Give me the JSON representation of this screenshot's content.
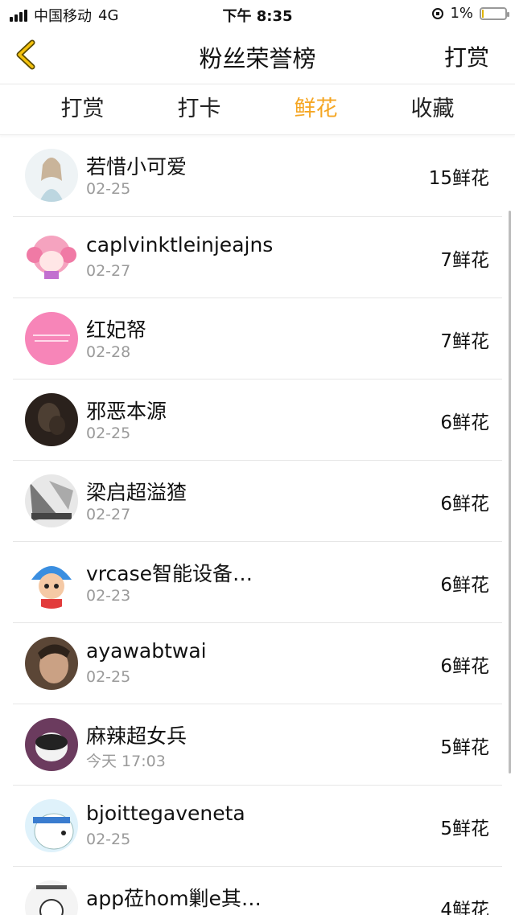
{
  "status": {
    "carrier": "中国移动",
    "network": "4G",
    "time": "下午 8:35",
    "battery": "1%"
  },
  "nav": {
    "title": "粉丝荣誉榜",
    "action": "打赏"
  },
  "tabs": [
    {
      "label": "打赏",
      "active": false
    },
    {
      "label": "打卡",
      "active": false
    },
    {
      "label": "鲜花",
      "active": true
    },
    {
      "label": "收藏",
      "active": false
    }
  ],
  "accent_color": "#f5a623",
  "fans": [
    {
      "name": "若惜小可爱",
      "date": "02-25",
      "count": "15鲜花",
      "avatar": "girl-photo-icon"
    },
    {
      "name": "caplvinktleinjeajns",
      "date": "02-27",
      "count": "7鲜花",
      "avatar": "pink-anime-icon"
    },
    {
      "name": "红妃帑",
      "date": "02-28",
      "count": "7鲜花",
      "avatar": "pink-circle-icon"
    },
    {
      "name": "邪恶本源",
      "date": "02-25",
      "count": "6鲜花",
      "avatar": "dark-photo-icon"
    },
    {
      "name": "梁启超溢猹",
      "date": "02-27",
      "count": "6鲜花",
      "avatar": "bw-photo-icon"
    },
    {
      "name": "vrcase智能设备…",
      "date": "02-23",
      "count": "6鲜花",
      "avatar": "cartoon-kid-icon"
    },
    {
      "name": "ayawabtwai",
      "date": "02-25",
      "count": "6鲜花",
      "avatar": "man-photo-icon"
    },
    {
      "name": "麻辣超女兵",
      "date": "今天 17:03",
      "count": "5鲜花",
      "avatar": "dog-photo-icon"
    },
    {
      "name": "bjoittegaveneta",
      "date": "02-25",
      "count": "5鲜花",
      "avatar": "polar-bear-icon"
    },
    {
      "name": "app莅hom剿e其…",
      "date": "",
      "count": "4鲜花",
      "avatar": "sketch-icon"
    }
  ]
}
